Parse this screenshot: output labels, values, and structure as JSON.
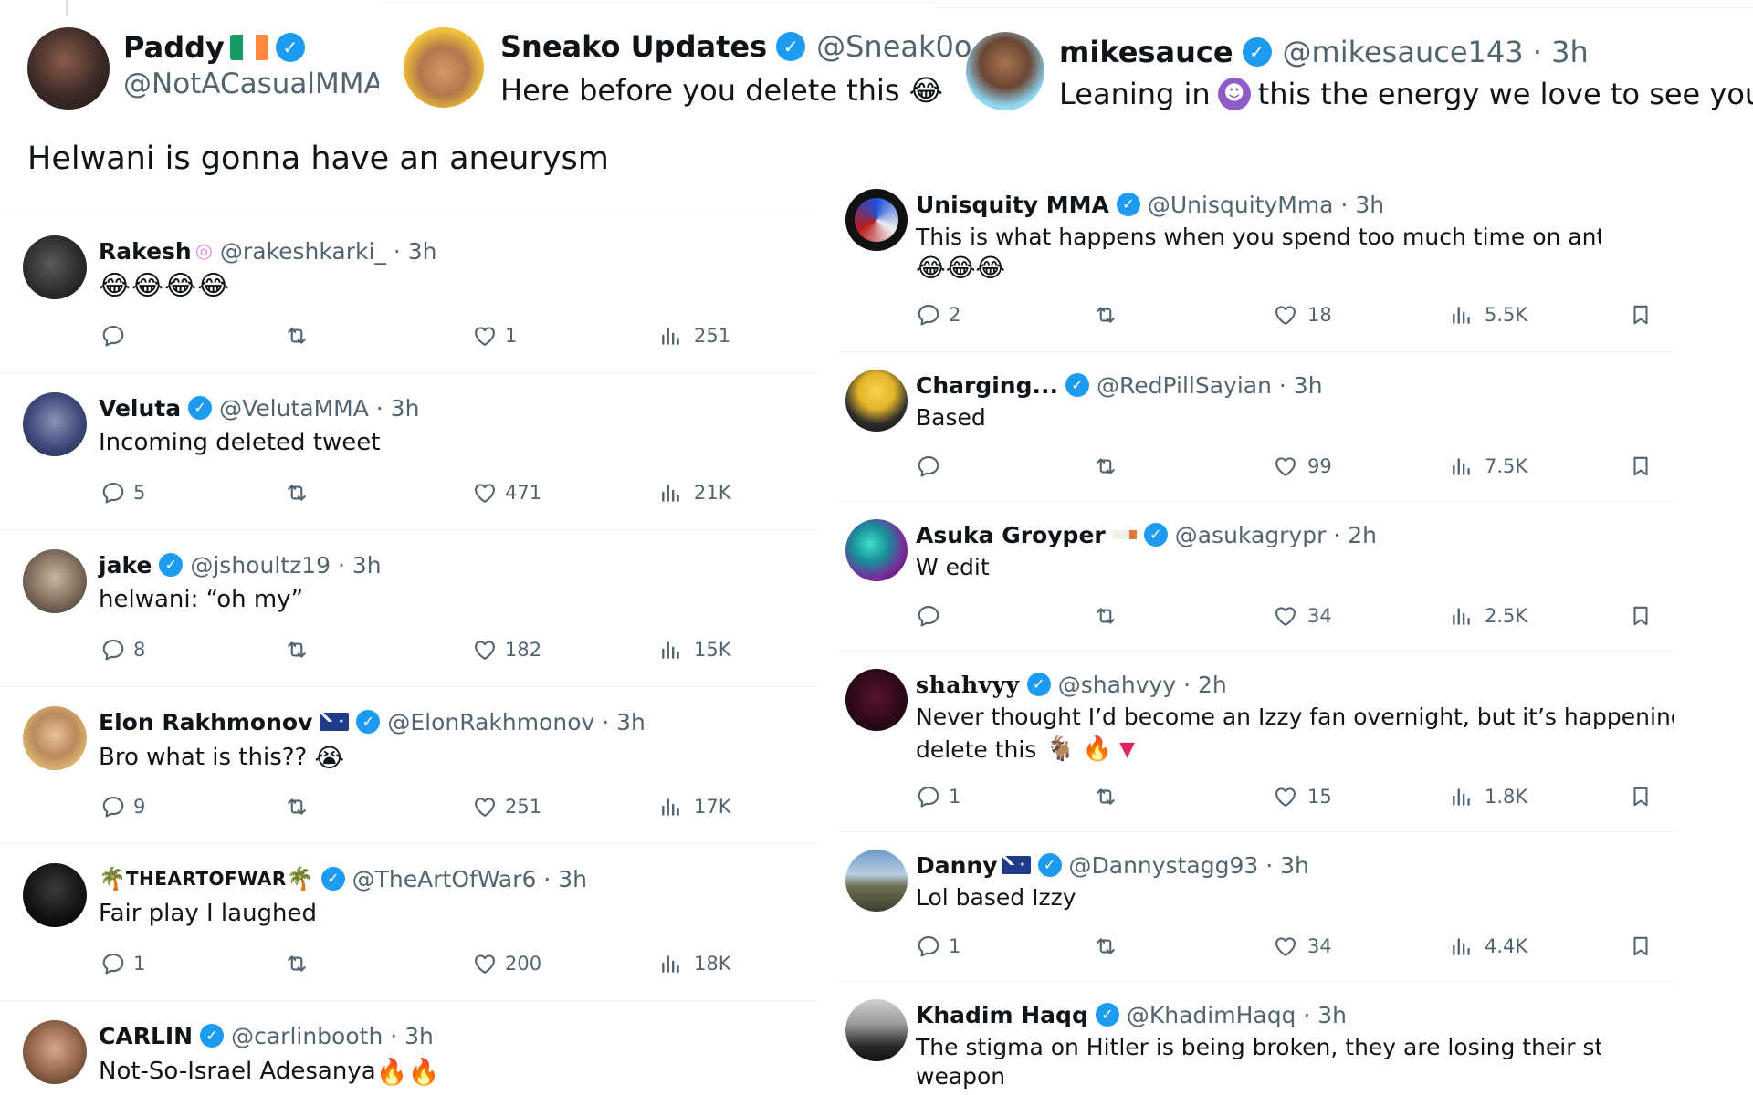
{
  "header": {
    "paddy": {
      "name": "Paddy",
      "handle": "@NotACasualMMA",
      "text": "Helwani is gonna have an aneurysm"
    },
    "sneako": {
      "name": "Sneako Updates",
      "handle": "@Sneak0o",
      "text": "Here before you delete this"
    },
    "mike": {
      "name": "mikesauce",
      "handle": "@mikesauce143 · 3h",
      "text_a": "Leaning in",
      "text_b": "this the energy we love to see you on!"
    }
  },
  "left_tweets": [
    {
      "name": "Rakesh",
      "handle": "@rakeshkarki_ · 3h",
      "text": "",
      "replies": "",
      "likes": "1",
      "views": "251"
    },
    {
      "name": "Veluta",
      "handle": "@VelutaMMA · 3h",
      "text": "Incoming deleted tweet",
      "replies": "5",
      "likes": "471",
      "views": "21K"
    },
    {
      "name": "jake",
      "handle": "@jshoultz19 · 3h",
      "text": "helwani: “oh my”",
      "replies": "8",
      "likes": "182",
      "views": "15K"
    },
    {
      "name": "Elon Rakhmonov",
      "handle": "@ElonRakhmonov · 3h",
      "text": "Bro what is this??",
      "replies": "9",
      "likes": "251",
      "views": "17K"
    },
    {
      "name": "THEARTOFWAR",
      "handle": "@TheArtOfWar6 · 3h",
      "text": "Fair play I laughed",
      "replies": "1",
      "likes": "200",
      "views": "18K"
    },
    {
      "name": "CARLIN",
      "handle": "@carlinbooth · 3h",
      "text": "Not-So-Israel Adesanya"
    }
  ],
  "right_tweets": [
    {
      "name": "Unisquity MMA",
      "handle": "@UnisquityMma · 3h",
      "text": "This is what happens when you spend too much time on antisemite twitt",
      "replies": "2",
      "likes": "18",
      "views": "5.5K"
    },
    {
      "name": "Charging...",
      "handle": "@RedPillSayian · 3h",
      "text": "Based",
      "replies": "",
      "likes": "99",
      "views": "7.5K"
    },
    {
      "name": "Asuka Groyper",
      "handle": "@asukagrypr · 2h",
      "text": "W edit",
      "replies": "",
      "likes": "34",
      "views": "2.5K"
    },
    {
      "name": "shahvyy",
      "handle": "@shahvyy · 2h",
      "text": "Never thought I’d become an Izzy fan overnight, but it’s happening, don’t",
      "text2": "delete this",
      "replies": "1",
      "likes": "15",
      "views": "1.8K"
    },
    {
      "name": "Danny",
      "handle": "@Dannystagg93 · 3h",
      "text": "Lol based Izzy",
      "replies": "1",
      "likes": "34",
      "views": "4.4K"
    },
    {
      "name": "Khadim Haqq",
      "handle": "@KhadimHaqq · 3h",
      "text": "The stigma on Hitler is being broken, they are losing their strongest verba",
      "text2": "weapon"
    }
  ],
  "colors": {
    "verified": "#1d9bf0",
    "text": "#0f1419",
    "muted": "#536471",
    "divider": "#eff3f4"
  },
  "icons": [
    "reply-icon",
    "retweet-icon",
    "like-icon",
    "views-icon",
    "bookmark-icon",
    "verified-badge-icon"
  ]
}
